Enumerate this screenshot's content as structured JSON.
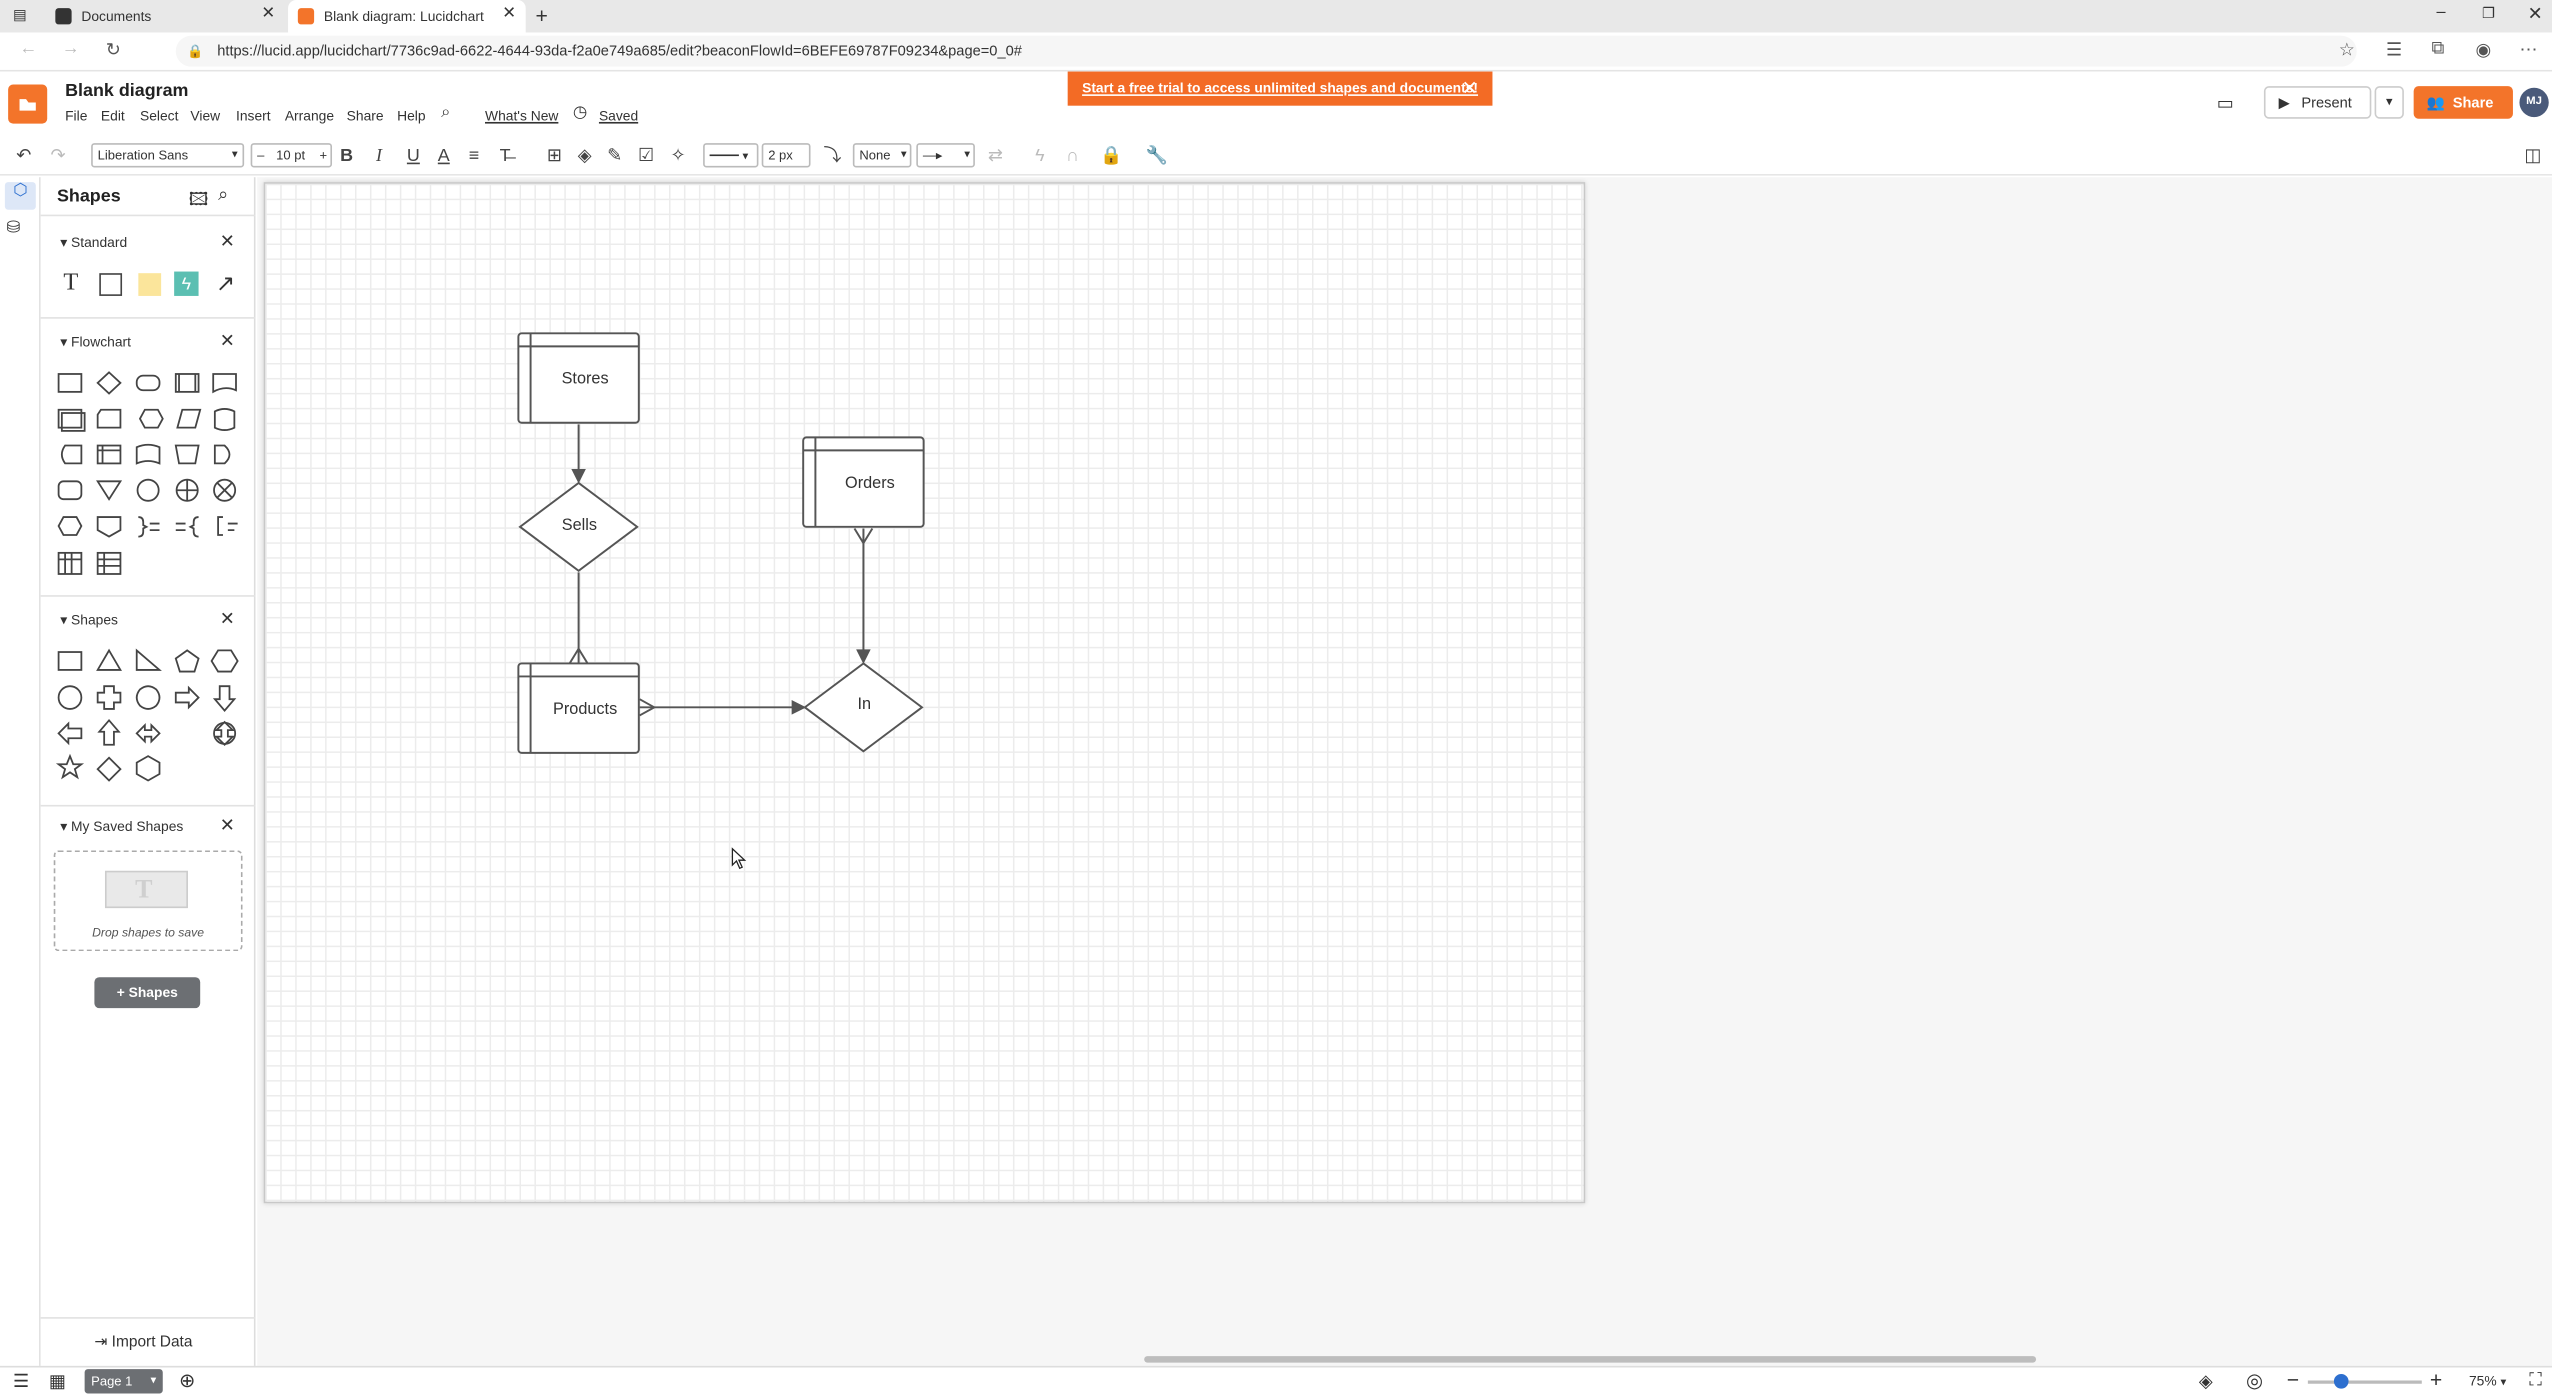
{
  "browser": {
    "tabs": [
      {
        "label": "Documents"
      },
      {
        "label": "Blank diagram: Lucidchart"
      }
    ],
    "url": "https://lucid.app/lucidchart/7736c9ad-6622-4644-93da-f2a0e749a685/edit?beaconFlowId=6BEFE69787F09234&page=0_0#"
  },
  "app": {
    "title": "Blank diagram",
    "menus": [
      "File",
      "Edit",
      "Select",
      "View",
      "Insert",
      "Arrange",
      "Share",
      "Help"
    ],
    "whats_new": "What's New",
    "save_status": "Saved",
    "banner": "Start a free trial to access unlimited shapes and documents!",
    "present_label": "Present",
    "share_label": "Share",
    "avatar_initials": "MJ",
    "brand_color": "#f3742a"
  },
  "toolbar": {
    "font": "Liberation Sans",
    "font_size": "10 pt",
    "line_width": "2 px",
    "arrow_start": "None"
  },
  "panel": {
    "title": "Shapes",
    "sections": [
      {
        "label": "Standard"
      },
      {
        "label": "Flowchart"
      },
      {
        "label": "Shapes"
      },
      {
        "label": "My Saved Shapes"
      }
    ],
    "drop_text": "Drop shapes to save",
    "add_shapes_label": "Shapes",
    "import_data": "Import Data"
  },
  "diagram": {
    "nodes": [
      {
        "id": "stores",
        "label": "Stores",
        "type": "entity"
      },
      {
        "id": "sells",
        "label": "Sells",
        "type": "relationship"
      },
      {
        "id": "orders",
        "label": "Orders",
        "type": "entity"
      },
      {
        "id": "products",
        "label": "Products",
        "type": "entity"
      },
      {
        "id": "in",
        "label": "In",
        "type": "relationship"
      }
    ],
    "edges": [
      {
        "from": "stores",
        "to": "sells",
        "end": "arrow"
      },
      {
        "from": "sells",
        "to": "products",
        "end": "crow-foot"
      },
      {
        "from": "orders",
        "to": "in",
        "start": "crow-foot",
        "end": "arrow"
      },
      {
        "from": "products",
        "to": "in",
        "start": "crow-foot",
        "end": "arrow"
      }
    ]
  },
  "footer": {
    "page_label": "Page 1",
    "zoom": "75%"
  }
}
